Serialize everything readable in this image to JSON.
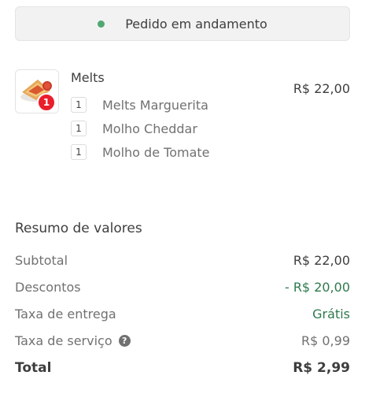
{
  "order_status": {
    "text": "Pedido em andamento",
    "dot_color": "#50a773"
  },
  "item": {
    "name": "Melts",
    "price": "R$ 22,00",
    "quantity": "1",
    "subitems": [
      {
        "qty": "1",
        "label": "Melts Marguerita"
      },
      {
        "qty": "1",
        "label": "Molho Cheddar"
      },
      {
        "qty": "1",
        "label": "Molho de Tomate"
      }
    ]
  },
  "summary": {
    "title": "Resumo de valores",
    "subtotal_label": "Subtotal",
    "subtotal_value": "R$ 22,00",
    "discount_label": "Descontos",
    "discount_value": "- R$ 20,00",
    "delivery_label": "Taxa de entrega",
    "delivery_value": "Grátis",
    "service_label": "Taxa de serviço",
    "service_help_icon": "?",
    "service_value": "R$ 0,99",
    "total_label": "Total",
    "total_value": "R$ 2,99"
  },
  "colors": {
    "brand_red": "#ea1d2c",
    "green": "#2e7a4c"
  }
}
